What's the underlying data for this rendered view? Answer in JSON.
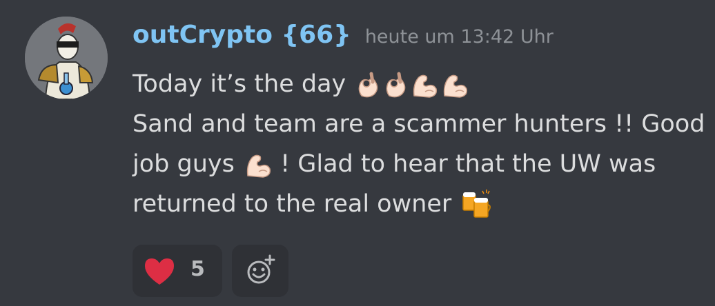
{
  "message": {
    "author": "outCrypto {66}",
    "timestamp": "heute um 13:42 Uhr",
    "lines": [
      "Today it’s the day",
      "Sand and team are a scammer hunters !! Good",
      "job guys",
      "! Glad to hear that the UW was",
      "returned to the real owner"
    ],
    "emojis": {
      "line1": [
        "ok-hand-emoji",
        "ok-hand-emoji",
        "flexed-biceps-emoji",
        "flexed-biceps-emoji"
      ],
      "line3": [
        "flexed-biceps-emoji"
      ],
      "line4": [
        "clinking-beer-mugs-emoji"
      ]
    }
  },
  "reactions": [
    {
      "icon": "heart-icon",
      "count": "5",
      "color": "#dd2e44"
    }
  ],
  "add_reaction": {
    "icon": "add-reaction-icon"
  },
  "colors": {
    "background": "#36393f",
    "username": "#7fc4f3",
    "timestamp": "#8e9297",
    "text": "#dcddde",
    "reaction_bg": "#2f3136"
  }
}
